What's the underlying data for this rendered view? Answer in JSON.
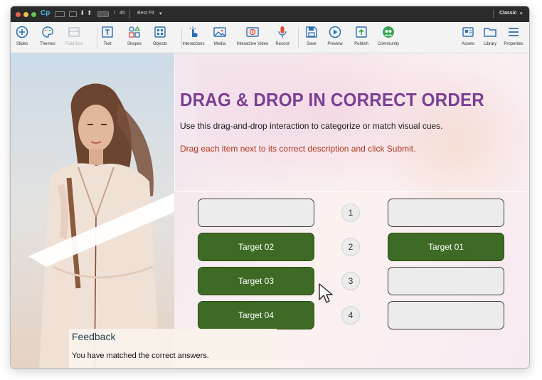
{
  "titlebar": {
    "app_logo": "Cp",
    "page_current": "",
    "page_total": "45",
    "zoom": "Best Fit",
    "workspace": "Classic"
  },
  "toolbar": {
    "tools": [
      {
        "label": "Slides",
        "icon": "plus-circle-icon"
      },
      {
        "label": "Themes",
        "icon": "palette-icon"
      },
      {
        "label": "Fluid Box",
        "icon": "fluid-box-icon",
        "disabled": true
      },
      {
        "label": "Text",
        "icon": "text-icon"
      },
      {
        "label": "Shapes",
        "icon": "shapes-icon"
      },
      {
        "label": "Objects",
        "icon": "objects-icon"
      },
      {
        "label": "Interactions",
        "icon": "hand-pointer-icon"
      },
      {
        "label": "Media",
        "icon": "image-icon"
      },
      {
        "label": "Interactive Video",
        "icon": "video-icon"
      },
      {
        "label": "Record",
        "icon": "microphone-icon"
      },
      {
        "label": "Save",
        "icon": "save-icon"
      },
      {
        "label": "Preview",
        "icon": "play-icon"
      },
      {
        "label": "Publish",
        "icon": "publish-icon"
      },
      {
        "label": "Community",
        "icon": "community-icon"
      },
      {
        "label": "Assets",
        "icon": "assets-icon"
      },
      {
        "label": "Library",
        "icon": "folder-icon"
      },
      {
        "label": "Properties",
        "icon": "menu-icon"
      }
    ]
  },
  "slide": {
    "title": "DRAG & DROP IN CORRECT ORDER",
    "subtitle": "Use this drag-and-drop interaction to categorize or match visual cues.",
    "instruction": "Drag each item next to its correct description and click Submit.",
    "left_column": [
      "",
      "Target 02",
      "Target 03",
      "Target 04"
    ],
    "numbers": [
      "1",
      "2",
      "3",
      "4"
    ],
    "right_column": [
      "",
      "Target 01",
      "",
      ""
    ],
    "feedback_title": "Feedback",
    "feedback_text": "You have matched the correct answers."
  },
  "colors": {
    "title_purple": "#7a3f94",
    "instruction_red": "#b0361e",
    "target_green": "#3d6a24",
    "titlebar_dark": "#2b2b2b"
  }
}
